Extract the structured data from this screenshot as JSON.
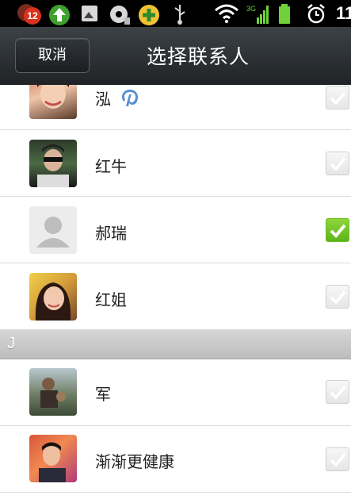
{
  "status_bar": {
    "notification_count": "12",
    "time": "11",
    "network_label": "3G",
    "icons": [
      "app-badge-icon",
      "upload-arrow-icon",
      "image-notification-icon",
      "media-notification-icon",
      "plus-circle-icon",
      "usb-icon",
      "wifi-icon",
      "signal-3g-icon",
      "battery-icon",
      "alarm-icon"
    ]
  },
  "header": {
    "cancel_label": "取消",
    "title": "选择联系人"
  },
  "contacts": [
    {
      "name": "泓",
      "checked": false,
      "avatar": "photo",
      "extra_icon": "pinterest-icon"
    },
    {
      "name": "红牛",
      "checked": false,
      "avatar": "photo"
    },
    {
      "name": "郝瑞",
      "checked": true,
      "avatar": "default-person-icon"
    },
    {
      "name": "红姐",
      "checked": false,
      "avatar": "photo"
    }
  ],
  "section": {
    "label": "J"
  },
  "contacts_j": [
    {
      "name": "军",
      "checked": false,
      "avatar": "photo"
    },
    {
      "name": "渐渐更健康",
      "checked": false,
      "avatar": "photo"
    }
  ],
  "colors": {
    "check_active": "#7bc92a",
    "titlebar": "#2b2f33",
    "section_bar": "#c9c9c9"
  }
}
